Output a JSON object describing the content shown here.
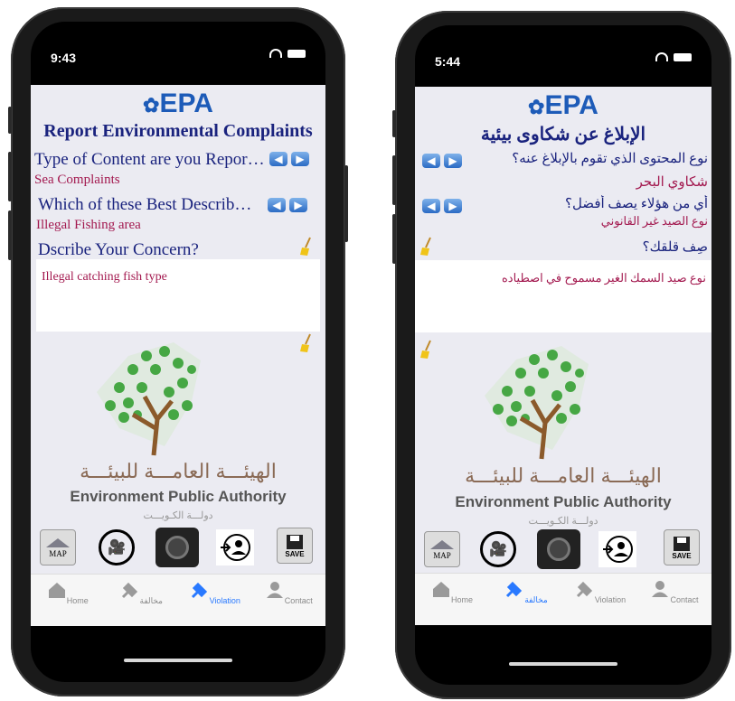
{
  "left": {
    "status_time": "9:43",
    "logo": "EPA",
    "title": "Report Environmental Complaints",
    "q1": "Type of Content are you Reporting?",
    "a1": "Sea Complaints",
    "q2": "Which of these Best Describes?",
    "a2": "Illegal Fishing area",
    "q3": "Dscribe Your Concern?",
    "concern": "Illegal catching fish type",
    "authority_ar": "الهيئـــة العامـــة للبيئـــة",
    "authority_en": "Environment Public Authority",
    "country_ar": "دولـــة الكـويـــت",
    "tools": [
      "MAP",
      "",
      "",
      "",
      "SAVE"
    ],
    "tabs": [
      "Home",
      "مخالفة",
      "Violation",
      "Contact"
    ],
    "active_tab": 2
  },
  "right": {
    "status_time": "5:44",
    "logo": "EPA",
    "title": "الإبلاغ عن شكاوى بيئية",
    "q1": "نوع المحتوى الذي تقوم بالإبلاغ عنه؟",
    "a1": "شكاوي البحر",
    "q2": "أي من هؤلاء يصف أفضل؟",
    "a2": "نوع الصيد غير القانوني",
    "q3": "صِف قلقك؟",
    "concern": "نوع صيد السمك الغير مسموح في اصطياده",
    "authority_ar": "الهيئـــة العامـــة للبيئـــة",
    "authority_en": "Environment Public Authority",
    "country_ar": "دولـــة الكـويـــت",
    "tools": [
      "MAP",
      "",
      "",
      "",
      "SAVE"
    ],
    "tabs": [
      "Home",
      "مخالفة",
      "Violation",
      "Contact"
    ],
    "active_tab": 1
  },
  "colors": {
    "accent": "#2979ff",
    "question": "#1a237e",
    "answer": "#a3194f",
    "logo": "#1d5bb8"
  }
}
